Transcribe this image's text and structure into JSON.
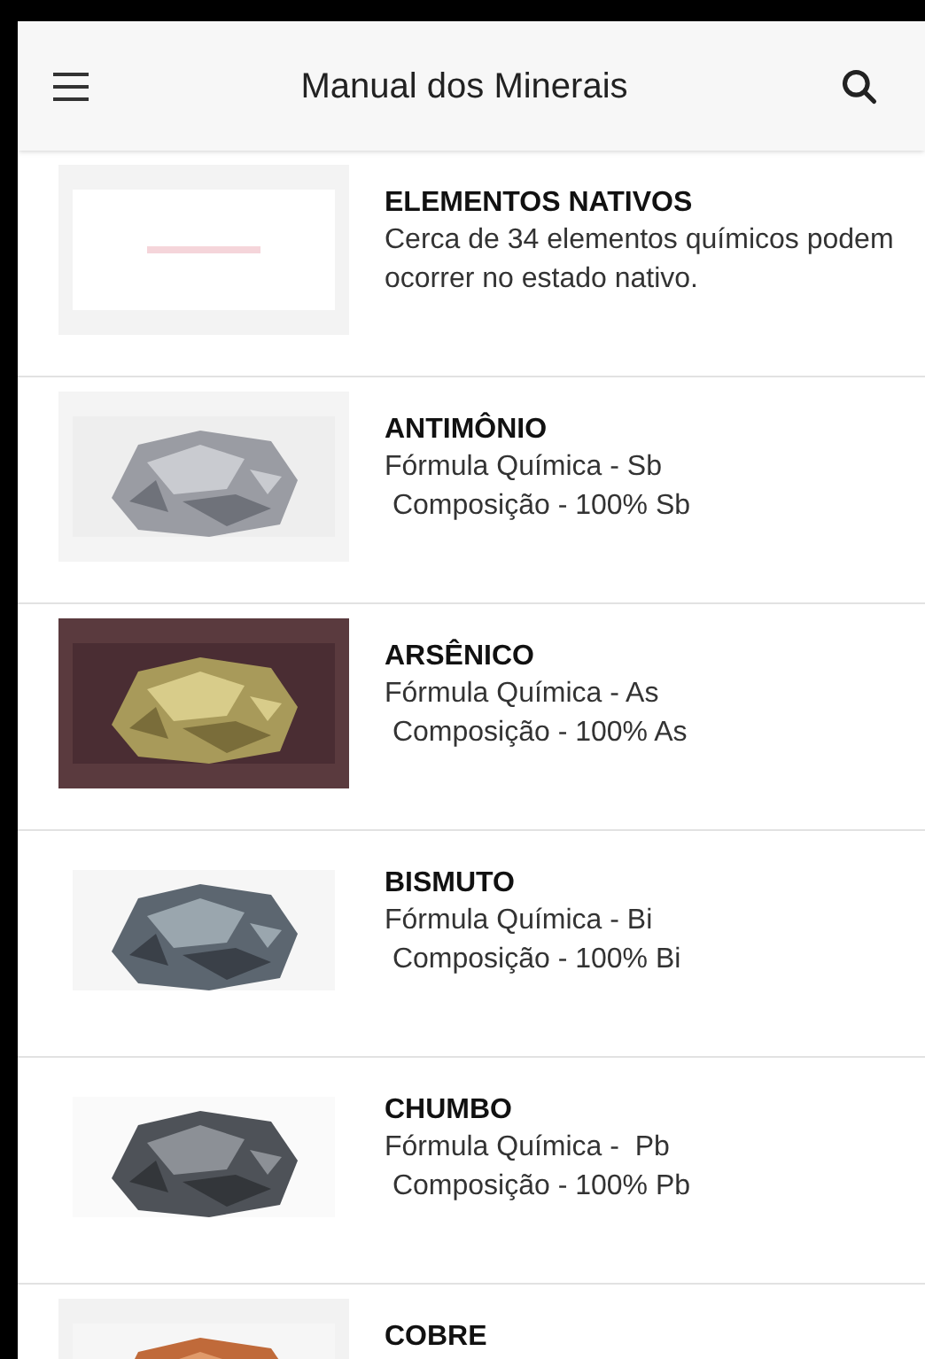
{
  "app_bar": {
    "title": "Manual dos Minerais"
  },
  "items": [
    {
      "name": "ELEMENTOS NATIVOS",
      "lines": [
        "Cerca de 34 elementos químicos podem ocorrer no estado nativo."
      ]
    },
    {
      "name": "ANTIMÔNIO",
      "lines": [
        "Fórmula Química - Sb",
        " Composição - 100% Sb"
      ]
    },
    {
      "name": "ARSÊNICO",
      "lines": [
        "Fórmula Química - As",
        " Composição - 100% As"
      ]
    },
    {
      "name": "BISMUTO",
      "lines": [
        "Fórmula Química - Bi",
        " Composição - 100% Bi"
      ]
    },
    {
      "name": "CHUMBO",
      "lines": [
        "Fórmula Química -  Pb",
        " Composição - 100% Pb"
      ]
    },
    {
      "name": "COBRE"
    }
  ]
}
